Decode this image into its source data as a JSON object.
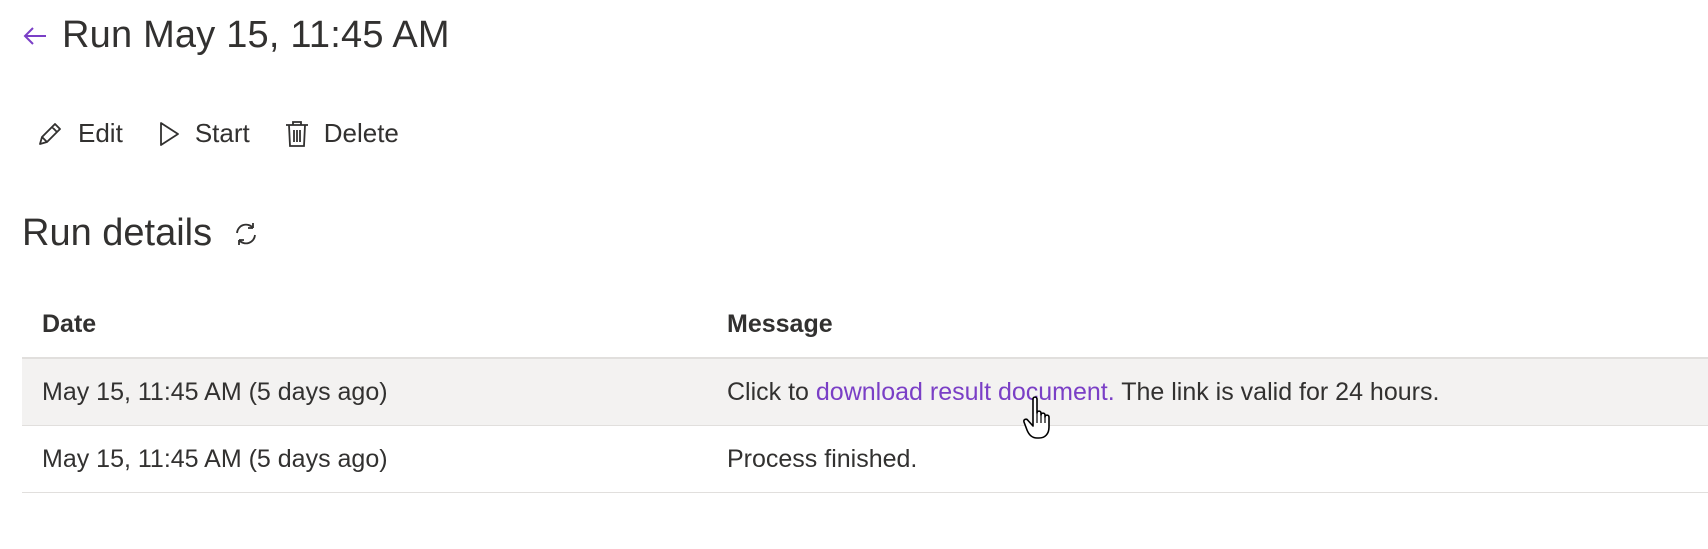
{
  "header": {
    "title": "Run May 15, 11:45 AM",
    "back_icon": "arrow-left-icon"
  },
  "toolbar": {
    "edit_label": "Edit",
    "start_label": "Start",
    "delete_label": "Delete"
  },
  "section": {
    "title": "Run details",
    "refresh_icon": "refresh-icon"
  },
  "table": {
    "columns": [
      "Date",
      "Message"
    ],
    "rows": [
      {
        "date": "May 15, 11:45 AM (5 days ago)",
        "message_prefix": "Click to ",
        "message_link": "download result document.",
        "message_suffix": " The link is valid for 24 hours."
      },
      {
        "date": "May 15, 11:45 AM (5 days ago)",
        "message": "Process finished."
      }
    ]
  },
  "colors": {
    "accent": "#7a3fc6",
    "text": "#323130",
    "row_hover": "#f3f2f1",
    "divider": "#e1dfdd"
  }
}
